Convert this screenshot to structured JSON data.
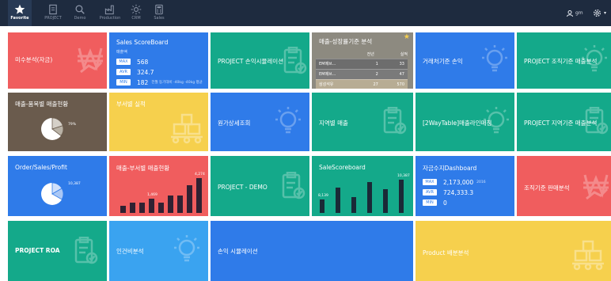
{
  "colors": {
    "topbar": "#1e2b3f",
    "red": "#f05d5e",
    "blue": "#2f7be9",
    "teal": "#14a98a",
    "yellow": "#f6d04d",
    "brown": "#6a5b4d",
    "sky": "#3aa3f0"
  },
  "nav": [
    {
      "label": "Favorite",
      "icon": "star-icon",
      "active": true
    },
    {
      "label": "PROJECT",
      "icon": "document-icon",
      "active": false
    },
    {
      "label": "Demo",
      "icon": "search-icon",
      "active": false
    },
    {
      "label": "Production",
      "icon": "factory-icon",
      "active": false
    },
    {
      "label": "CRM",
      "icon": "sun-icon",
      "active": false
    },
    {
      "label": "Sales",
      "icon": "calculator-icon",
      "active": false
    }
  ],
  "user": {
    "name": "gm",
    "icon": "user-icon",
    "settings_icon": "gear-icon"
  },
  "tiles": {
    "t1": {
      "title": "미수분석(자금)",
      "icon": "won-chart-icon"
    },
    "t2": {
      "title": "Sales ScoreBoard",
      "subtitle": "매출액",
      "rows": [
        {
          "badge": "MAX",
          "value": "568",
          "note": ""
        },
        {
          "badge": "AVR",
          "value": "324.7",
          "note": ""
        },
        {
          "badge": "MIN",
          "value": "182",
          "note": "전월 동기대비 -40kg -40kg 평균"
        }
      ]
    },
    "t3": {
      "title": "PROJECT 손익시뮬레이션",
      "icon": "clipboard-check-icon"
    },
    "t4": {
      "title": "매출-성장률기준 분석",
      "columns": [
        "",
        "전년",
        "실적"
      ],
      "rows": [
        {
          "name": "EM메브...",
          "a": "1",
          "b": "33"
        },
        {
          "name": "EM메브...",
          "a": "2",
          "b": "47"
        },
        {
          "name": "삼성석유",
          "a": "27",
          "b": "570"
        }
      ],
      "favorite_icon": "star-icon"
    },
    "t5": {
      "title": "거래처기준 손익",
      "icon": "lightbulb-icon"
    },
    "t6": {
      "title": "PROJECT 조직기준 매출분석",
      "icon": "lightbulb-icon"
    },
    "t7": {
      "title": "매출-품목별 매출현황",
      "pie_label": "79%"
    },
    "t8": {
      "title": "부서별 실적",
      "icon": "conveyor-icon"
    },
    "t9": {
      "title": "원가상세조회",
      "icon": "lightbulb-icon"
    },
    "t10": {
      "title": "지역별 매출",
      "icon": "clipboard-check-icon"
    },
    "t11": {
      "title": "[2WayTable]매출라인매칭",
      "icon": "lightbulb-icon"
    },
    "t12": {
      "title": "PROJECT 지역기준 매출분석",
      "icon": "clipboard-check-icon"
    },
    "t13": {
      "title": "Order/Sales/Profit",
      "pie_label": "10,387"
    },
    "t14": {
      "title": "매출-부서별 매출현황",
      "bars": [
        2,
        3,
        3,
        4,
        3,
        5,
        5,
        8,
        10
      ],
      "labels": [
        {
          "bar": 3,
          "text": "1,469"
        },
        {
          "bar": 8,
          "text": "4,274"
        }
      ]
    },
    "t15": {
      "title": "PROJECT - DEMO",
      "icon": "clipboard-check-icon"
    },
    "t16": {
      "title": "SaleScoreboard",
      "bars": [
        2.2,
        4.2,
        2.6,
        5.2,
        4.0,
        5.6
      ],
      "labels": [
        {
          "bar": 0,
          "text": "8,139"
        },
        {
          "bar": 5,
          "text": "10,387"
        }
      ]
    },
    "t17": {
      "title": "자금수지Dashboard",
      "rows": [
        {
          "badge": "MAX",
          "value": "2,173,000",
          "note": "2016"
        },
        {
          "badge": "AVR",
          "value": "724,333.3",
          "note": ""
        },
        {
          "badge": "MIN",
          "value": "0",
          "note": ""
        }
      ]
    },
    "t18": {
      "title": "조직기준 판매분석",
      "icon": "won-chart-icon"
    },
    "t19": {
      "title": "PROJECT ROA",
      "icon": "clipboard-check-icon"
    },
    "t20": {
      "title": "인건비분석",
      "icon": "lightbulb-icon"
    },
    "t21": {
      "title": "손익 시뮬레이션"
    },
    "t22": {
      "title": "Product 배분분석",
      "icon": "conveyor-icon"
    }
  }
}
